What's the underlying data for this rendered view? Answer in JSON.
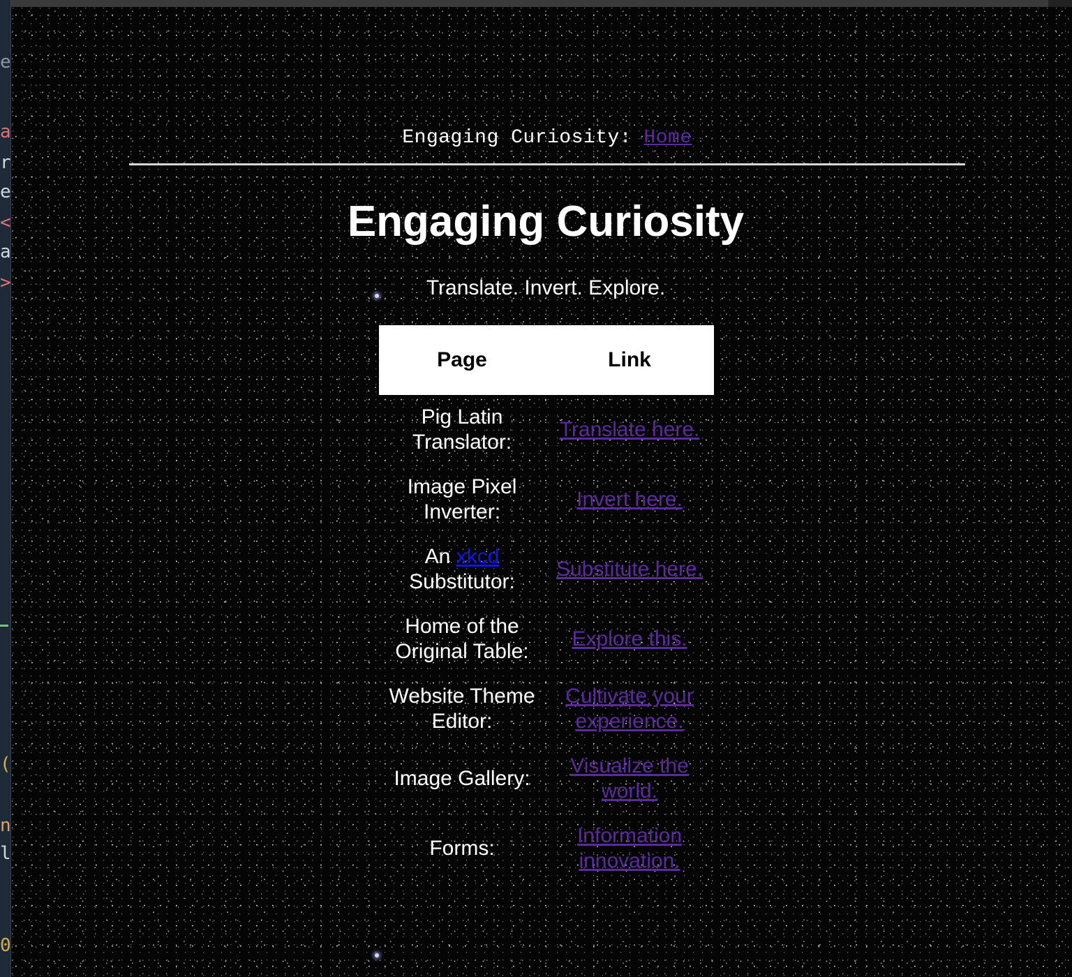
{
  "editor": {
    "glyphs": [
      {
        "char": "e",
        "color": "#8899aa"
      },
      {
        "char": "a",
        "color": "#e0707a"
      },
      {
        "char": "r",
        "color": "#d0d8e0"
      },
      {
        "char": "e",
        "color": "#d0d8e0"
      },
      {
        "char": "<",
        "color": "#e0707a"
      },
      {
        "char": "a",
        "color": "#d0d8e0"
      },
      {
        "char": ">",
        "color": "#e0707a"
      },
      {
        "char": "(",
        "color": "#d8b04a"
      },
      {
        "char": "n",
        "color": "#e0a060"
      },
      {
        "char": "l",
        "color": "#d0d8e0"
      },
      {
        "char": "0",
        "color": "#d8b04a"
      }
    ]
  },
  "nav": {
    "site_label": "Engaging Curiosity:",
    "home_label": "Home"
  },
  "header": {
    "title": "Engaging Curiosity",
    "tagline": "Translate. Invert. Explore."
  },
  "table": {
    "columns": [
      "Page",
      "Link"
    ],
    "rows": [
      {
        "page_line1": "Pig Latin",
        "page_line2": "Translator:",
        "link": "Translate here."
      },
      {
        "page_line1": "Image Pixel",
        "page_line2": "Inverter:",
        "link": "Invert here."
      },
      {
        "page_prefix": "An",
        "page_inline_link": "xkcd",
        "page_line2": "Substitutor:",
        "link": "Substitute here."
      },
      {
        "page_line1": "Home of the",
        "page_line2": "Original Table:",
        "link": "Explore this."
      },
      {
        "page_line1": "Website Theme",
        "page_line2": "Editor:",
        "link_line1": "Cultivate your",
        "link_line2": "experience."
      },
      {
        "page_line1": "Image Gallery:",
        "link_line1": "Visualize the",
        "link_line2": "world."
      },
      {
        "page_line1": "Forms:",
        "link_line1": "Information",
        "link_line2": "innovation."
      }
    ]
  },
  "colors": {
    "background": "#000000",
    "visited_link": "#5b2a9c",
    "inline_link": "#1414e8",
    "text": "#ffffff",
    "header_cell": "#ffffff"
  }
}
